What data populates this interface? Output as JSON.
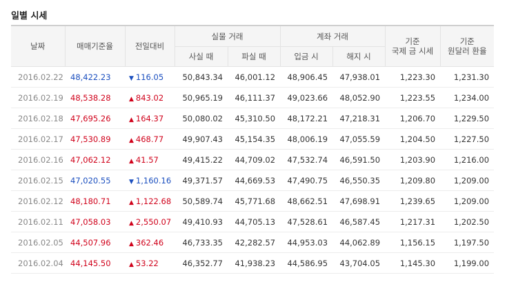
{
  "section_title": "일별 시세",
  "headers": {
    "date": "날짜",
    "base_rate": "매매기준율",
    "change": "전일대비",
    "physical": "실물 거래",
    "physical_buy": "사실 때",
    "physical_sell": "파실 때",
    "account": "계좌 거래",
    "account_deposit": "입금 시",
    "account_withdraw": "해지 시",
    "intl_line1": "기준",
    "intl_line2": "국제 금 시세",
    "usd_line1": "기준",
    "usd_line2": "원달러 환율"
  },
  "colors": {
    "up": "#d0021b",
    "down": "#1b4fbf"
  },
  "rows": [
    {
      "date": "2016.02.22",
      "rate": "48,422.23",
      "dir": "down",
      "arrow": "▼",
      "change": "116.05",
      "buy": "50,843.34",
      "sell": "46,001.12",
      "deposit": "48,906.45",
      "withdraw": "47,938.01",
      "intl": "1,223.30",
      "usd": "1,231.30"
    },
    {
      "date": "2016.02.19",
      "rate": "48,538.28",
      "dir": "up",
      "arrow": "▲",
      "change": "843.02",
      "buy": "50,965.19",
      "sell": "46,111.37",
      "deposit": "49,023.66",
      "withdraw": "48,052.90",
      "intl": "1,223.55",
      "usd": "1,234.00"
    },
    {
      "date": "2016.02.18",
      "rate": "47,695.26",
      "dir": "up",
      "arrow": "▲",
      "change": "164.37",
      "buy": "50,080.02",
      "sell": "45,310.50",
      "deposit": "48,172.21",
      "withdraw": "47,218.31",
      "intl": "1,206.70",
      "usd": "1,229.50"
    },
    {
      "date": "2016.02.17",
      "rate": "47,530.89",
      "dir": "up",
      "arrow": "▲",
      "change": "468.77",
      "buy": "49,907.43",
      "sell": "45,154.35",
      "deposit": "48,006.19",
      "withdraw": "47,055.59",
      "intl": "1,204.50",
      "usd": "1,227.50"
    },
    {
      "date": "2016.02.16",
      "rate": "47,062.12",
      "dir": "up",
      "arrow": "▲",
      "change": "41.57",
      "buy": "49,415.22",
      "sell": "44,709.02",
      "deposit": "47,532.74",
      "withdraw": "46,591.50",
      "intl": "1,203.90",
      "usd": "1,216.00"
    },
    {
      "date": "2016.02.15",
      "rate": "47,020.55",
      "dir": "down",
      "arrow": "▼",
      "change": "1,160.16",
      "buy": "49,371.57",
      "sell": "44,669.53",
      "deposit": "47,490.75",
      "withdraw": "46,550.35",
      "intl": "1,209.80",
      "usd": "1,209.00"
    },
    {
      "date": "2016.02.12",
      "rate": "48,180.71",
      "dir": "up",
      "arrow": "▲",
      "change": "1,122.68",
      "buy": "50,589.74",
      "sell": "45,771.68",
      "deposit": "48,662.51",
      "withdraw": "47,698.91",
      "intl": "1,239.65",
      "usd": "1,209.00"
    },
    {
      "date": "2016.02.11",
      "rate": "47,058.03",
      "dir": "up",
      "arrow": "▲",
      "change": "2,550.07",
      "buy": "49,410.93",
      "sell": "44,705.13",
      "deposit": "47,528.61",
      "withdraw": "46,587.45",
      "intl": "1,217.31",
      "usd": "1,202.50"
    },
    {
      "date": "2016.02.05",
      "rate": "44,507.96",
      "dir": "up",
      "arrow": "▲",
      "change": "362.46",
      "buy": "46,733.35",
      "sell": "42,282.57",
      "deposit": "44,953.03",
      "withdraw": "44,062.89",
      "intl": "1,156.15",
      "usd": "1,197.50"
    },
    {
      "date": "2016.02.04",
      "rate": "44,145.50",
      "dir": "up",
      "arrow": "▲",
      "change": "53.22",
      "buy": "46,352.77",
      "sell": "41,938.23",
      "deposit": "44,586.95",
      "withdraw": "43,704.05",
      "intl": "1,145.30",
      "usd": "1,199.00"
    }
  ]
}
